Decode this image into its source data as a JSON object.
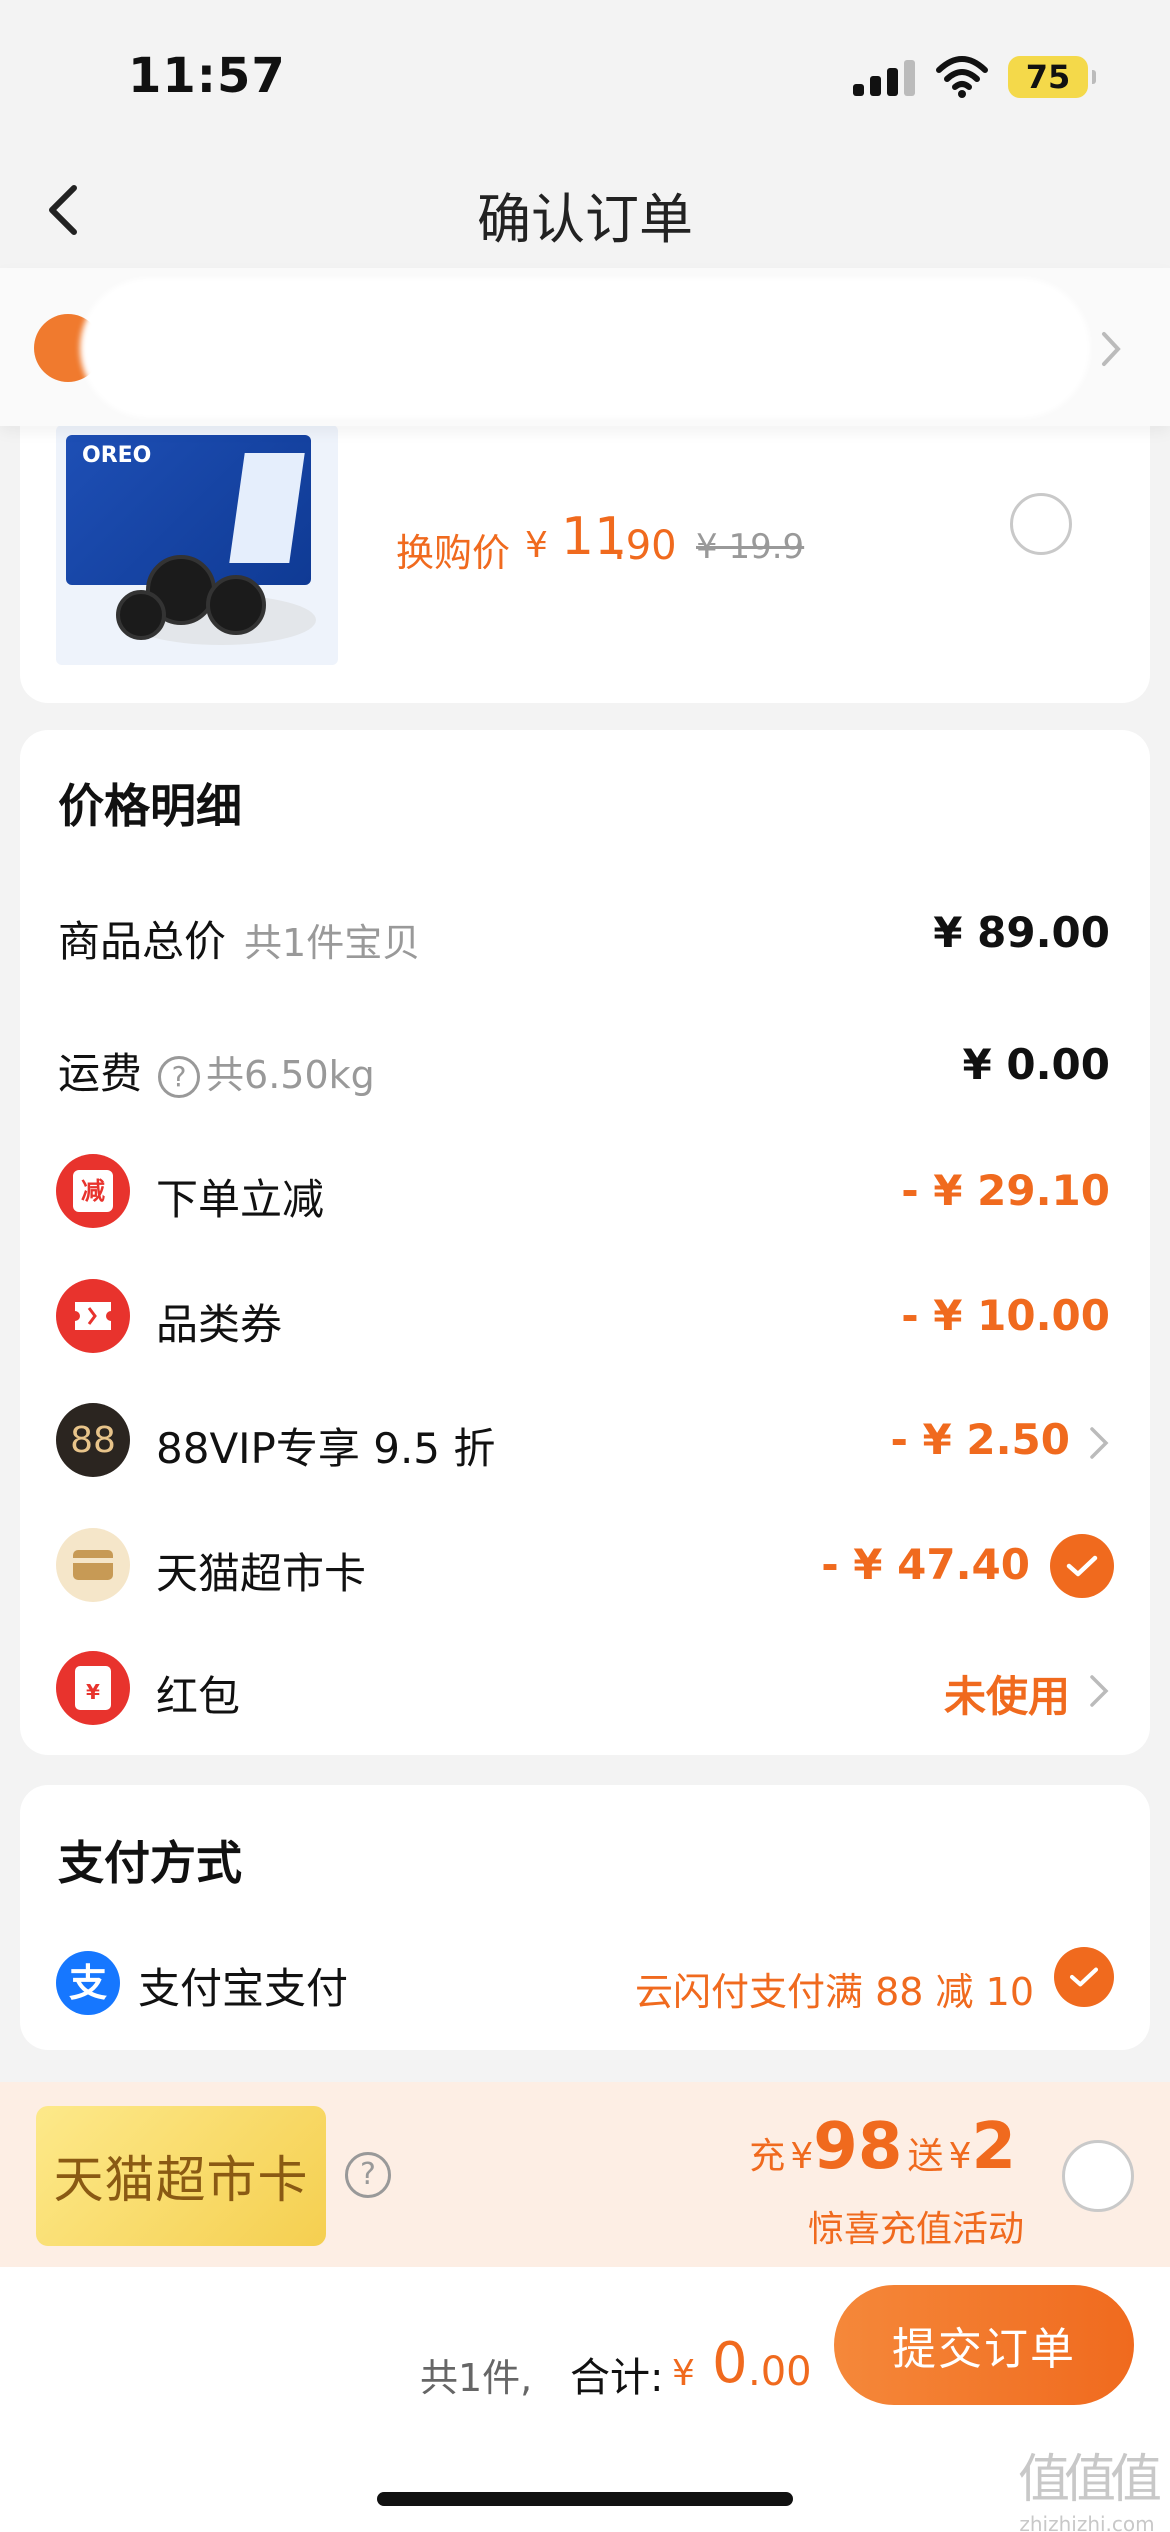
{
  "status_bar": {
    "time": "11:57",
    "battery": "75"
  },
  "nav": {
    "title": "确认订单"
  },
  "product": {
    "exchange_label": "换购价",
    "price_yen": "¥",
    "price_int": "11",
    "price_dec": ".90",
    "original_price": "¥ 19.9"
  },
  "price_detail": {
    "title": "价格明细",
    "items": [
      {
        "label": "商品总价",
        "sub": "共1件宝贝",
        "value": "¥ 89.00"
      },
      {
        "label": "运费",
        "sub": "共6.50kg",
        "value": "¥ 0.00",
        "help_icon": "?"
      },
      {
        "label": "下单立减",
        "icon_text": "减",
        "value": "- ¥ 29.10"
      },
      {
        "label": "品类券",
        "value": "- ¥ 10.00"
      },
      {
        "label": "88VIP专享 9.5 折",
        "icon_text": "88",
        "value": "- ¥ 2.50"
      },
      {
        "label": "天猫超市卡",
        "value": "- ¥ 47.40"
      },
      {
        "label": "红包",
        "icon_text": "¥",
        "value": "未使用"
      }
    ]
  },
  "payment": {
    "title": "支付方式",
    "icon_text": "支",
    "method": "支付宝支付",
    "promo": "云闪付支付满 88 减 10"
  },
  "topup": {
    "card_name": "天猫超市卡",
    "help_icon": "?",
    "charge_label": "充",
    "yen": "¥",
    "charge_amount": "98",
    "bonus_label": "送",
    "bonus_amount": "2",
    "subtitle": "惊喜充值活动"
  },
  "footer": {
    "count": "共1件,",
    "total_label": "合计:",
    "total_yen": "¥",
    "total_int": "0",
    "total_dec": ".00",
    "submit_label": "提交订单"
  },
  "watermark": {
    "main": "值值值",
    "sub": "zhizhizhi.com"
  },
  "colors": {
    "accent": "#f06a1e",
    "alipay": "#1677ff",
    "red_icon": "#e8332d",
    "vip_icon": "#2b2520"
  }
}
